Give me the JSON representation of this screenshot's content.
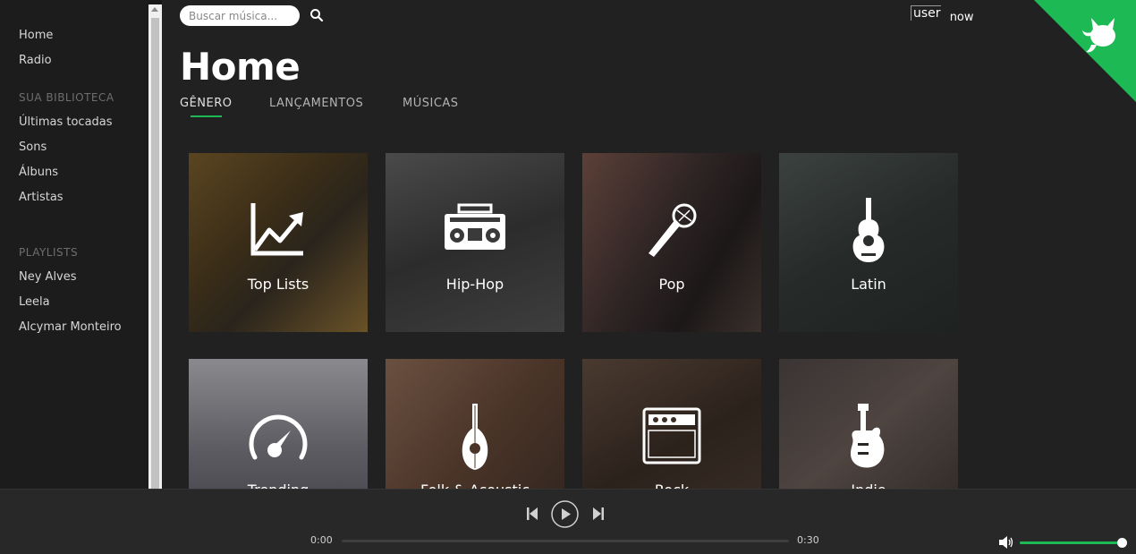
{
  "sidebar": {
    "nav": [
      {
        "label": "Home"
      },
      {
        "label": "Radio"
      }
    ],
    "library_title": "SUA BIBLIOTECA",
    "library": [
      {
        "label": "Últimas tocadas"
      },
      {
        "label": "Sons"
      },
      {
        "label": "Álbuns"
      },
      {
        "label": "Artistas"
      }
    ],
    "playlists_title": "PLAYLISTS",
    "playlists": [
      {
        "label": "Ney Alves"
      },
      {
        "label": "Leela"
      },
      {
        "label": "Alcymar Monteiro"
      }
    ]
  },
  "header": {
    "search_placeholder": "Buscar música...",
    "user_alt": "user",
    "user_status": "now"
  },
  "page": {
    "title": "Home",
    "tabs": [
      {
        "label": "GÊNERO",
        "active": true
      },
      {
        "label": "LANÇAMENTOS",
        "active": false
      },
      {
        "label": "MÚSICAS",
        "active": false
      }
    ]
  },
  "genres": [
    {
      "label": "Top Lists",
      "icon": "chart-trend-icon"
    },
    {
      "label": "Hip-Hop",
      "icon": "boombox-icon"
    },
    {
      "label": "Pop",
      "icon": "microphone-icon"
    },
    {
      "label": "Latin",
      "icon": "acoustic-guitar-icon"
    },
    {
      "label": "Trending",
      "icon": "speedometer-icon"
    },
    {
      "label": "Folk & Acoustic",
      "icon": "mandolin-icon"
    },
    {
      "label": "Rock",
      "icon": "amplifier-icon"
    },
    {
      "label": "Indie",
      "icon": "electric-guitar-icon"
    }
  ],
  "player": {
    "current_time": "0:00",
    "duration": "0:30",
    "progress_fraction": 0,
    "volume_fraction": 1.0
  },
  "colors": {
    "accent": "#1db954",
    "sidebar_bg": "#1c1c1c",
    "main_bg": "#212121",
    "player_bg": "#282828"
  }
}
